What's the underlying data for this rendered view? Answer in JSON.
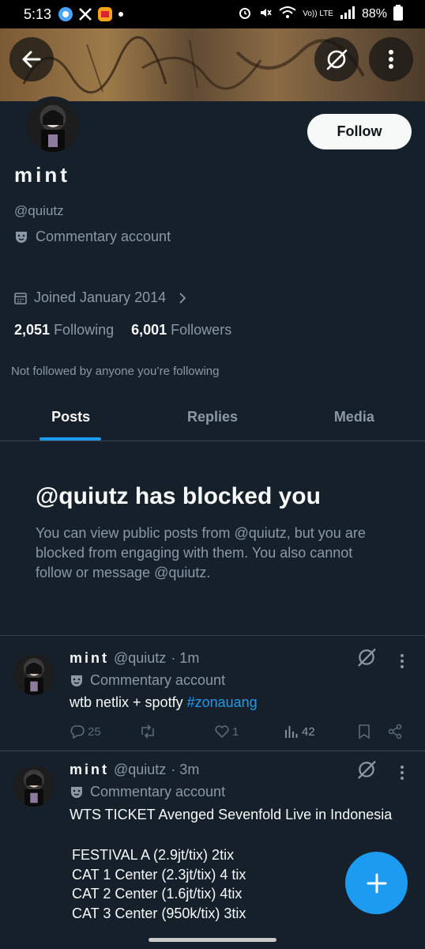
{
  "status_bar": {
    "time": "5:13",
    "battery": "88%",
    "network": "Vo)) LTE"
  },
  "profile": {
    "display_name": "mint",
    "handle": "@quiutz",
    "label": "Commentary account",
    "joined": "Joined January 2014",
    "following_count": "2,051",
    "following_label": "Following",
    "followers_count": "6,001",
    "followers_label": "Followers",
    "not_followed": "Not followed by anyone you’re following",
    "follow_button": "Follow"
  },
  "tabs": [
    {
      "label": "Posts",
      "active": true
    },
    {
      "label": "Replies",
      "active": false
    },
    {
      "label": "Media",
      "active": false
    }
  ],
  "blocked": {
    "title": "@quiutz has blocked you",
    "body": "You can view public posts from @quiutz, but you are blocked from engaging with them. You also cannot follow or message @quiutz."
  },
  "posts": [
    {
      "name": "mint",
      "handle": "@quiutz",
      "time": "· 1m",
      "label": "Commentary account",
      "text": "wtb netlix + spotfy ",
      "hashtag": "#zonauang",
      "replies": "25",
      "likes": "1",
      "views": "42"
    },
    {
      "name": "mint",
      "handle": "@quiutz",
      "time": "· 3m",
      "label": "Commentary account",
      "lines": [
        "WTS TICKET Avenged Sevenfold Live in Indonesia",
        "",
        "FESTIVAL A (2.9jt/tix) 2tix",
        "CAT 1 Center (2.3jt/tix) 4 tix",
        "CAT 2 Center (1.6jt/tix) 4tix",
        "CAT 3 Center (950k/tix) 3tix"
      ]
    }
  ],
  "colors": {
    "accent": "#1d9bf0",
    "background": "#15202b",
    "muted": "#8b98a5"
  }
}
